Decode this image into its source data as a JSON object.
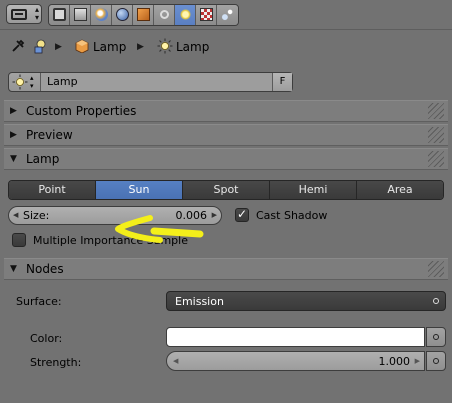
{
  "context_tabs": [
    "render-icon",
    "render-layers-icon",
    "scene-icon",
    "world-icon",
    "object-icon",
    "constraints-icon",
    "lamp-data-icon",
    "texture-icon",
    "particles-icon"
  ],
  "active_context": "lamp-data-icon",
  "breadcrumb": {
    "items": [
      "Lamp",
      "Lamp"
    ]
  },
  "datablock": {
    "name": "Lamp",
    "fake_user": "F"
  },
  "panels": {
    "custom_properties": "Custom Properties",
    "preview": "Preview",
    "lamp": "Lamp",
    "nodes": "Nodes"
  },
  "lamp_types": [
    {
      "label": "Point",
      "active": false
    },
    {
      "label": "Sun",
      "active": true
    },
    {
      "label": "Spot",
      "active": false
    },
    {
      "label": "Hemi",
      "active": false
    },
    {
      "label": "Area",
      "active": false
    }
  ],
  "size": {
    "label": "Size:",
    "value": "0.006"
  },
  "cast_shadow": {
    "label": "Cast Shadow",
    "checked": true
  },
  "multiple_importance": {
    "label": "Multiple Importance Sample",
    "checked": false
  },
  "nodes": {
    "surface_label": "Surface:",
    "surface_value": "Emission",
    "color_label": "Color:",
    "color_value": "#ffffff",
    "strength_label": "Strength:",
    "strength_value": "1.000"
  },
  "colors": {
    "accent": "#5680c2",
    "annotation": "#f4ef1a",
    "background": "#727272"
  }
}
